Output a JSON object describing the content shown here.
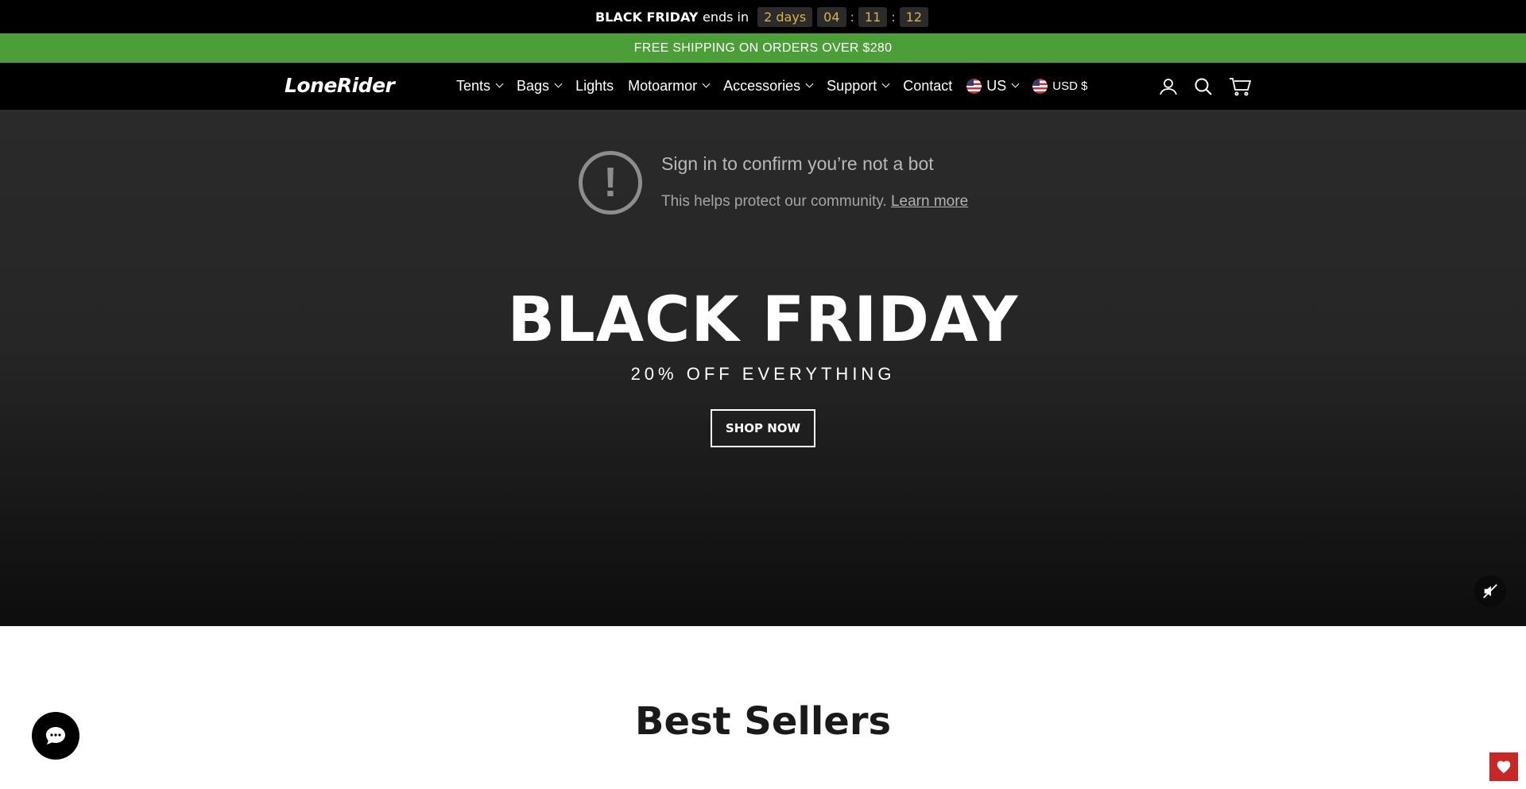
{
  "countdown": {
    "label_bold": "BLACK FRIDAY",
    "label_rest": "ends in",
    "days": "2 days",
    "hours": "04",
    "minutes": "11",
    "seconds": "12",
    "separator": ":"
  },
  "shipping_banner": "FREE SHIPPING ON ORDERS OVER $280",
  "header": {
    "logo": "LoneRider",
    "nav": [
      {
        "label": "Tents",
        "dropdown": true
      },
      {
        "label": "Bags",
        "dropdown": true
      },
      {
        "label": "Lights",
        "dropdown": false
      },
      {
        "label": "Motoarmor",
        "dropdown": true
      },
      {
        "label": "Accessories",
        "dropdown": true
      },
      {
        "label": "Support",
        "dropdown": true
      },
      {
        "label": "Contact",
        "dropdown": false
      }
    ],
    "country": "US",
    "currency": "USD $",
    "icons": [
      "account-icon",
      "search-icon",
      "cart-icon"
    ]
  },
  "hero": {
    "bot_notice_title": "Sign in to confirm you’re not a bot",
    "bot_notice_text": "This helps protect our community.",
    "bot_notice_link": "Learn more",
    "bot_icon_glyph": "!",
    "title": "BLACK FRIDAY",
    "subtitle": "20% OFF EVERYTHING",
    "cta": "SHOP NOW"
  },
  "sections": {
    "best_sellers_title": "Best Sellers"
  },
  "colors": {
    "shipping_bar": "#4c9e38",
    "countdown_digits": "#d9b24a",
    "wishlist": "#c62828"
  }
}
